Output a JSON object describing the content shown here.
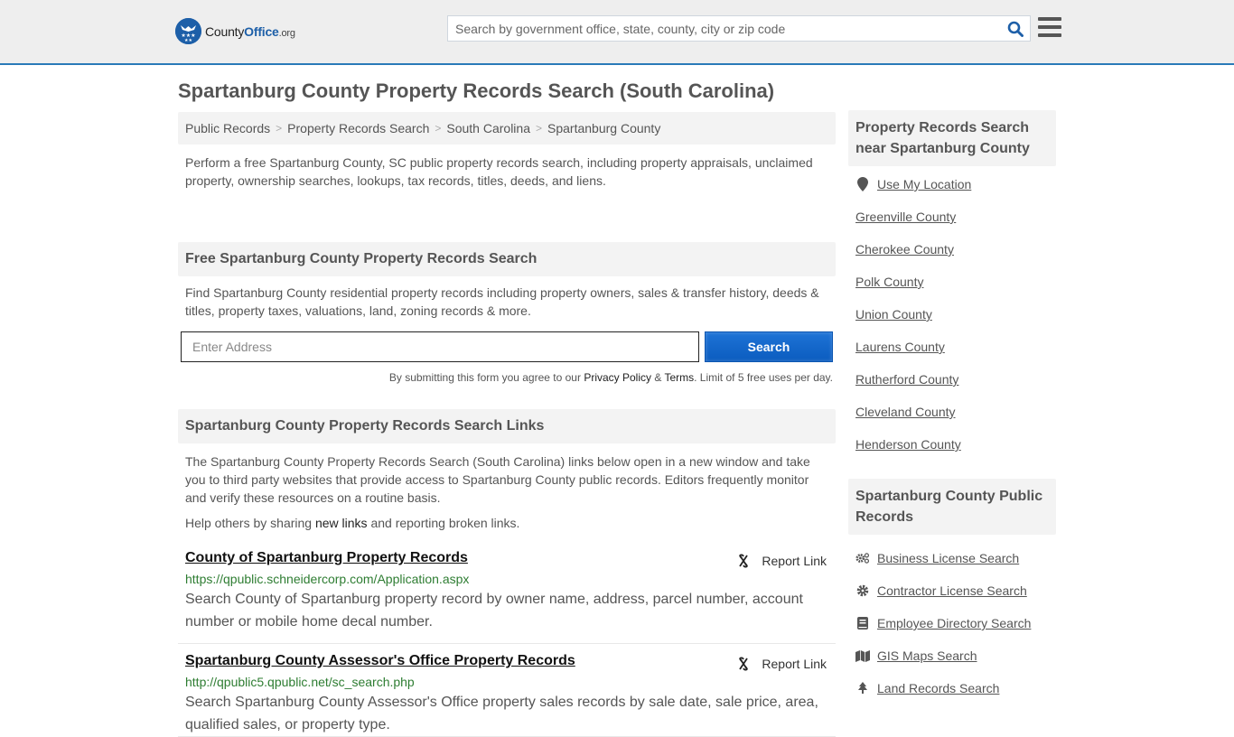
{
  "header": {
    "logo": {
      "county": "County",
      "office": "Office",
      "org": ".org"
    },
    "search_placeholder": "Search by government office, state, county, city or zip code"
  },
  "page_title": "Spartanburg County Property Records Search (South Carolina)",
  "breadcrumb": [
    {
      "label": "Public Records"
    },
    {
      "label": "Property Records Search"
    },
    {
      "label": "South Carolina"
    },
    {
      "label": "Spartanburg County"
    }
  ],
  "breadcrumb_separator": ">",
  "intro": "Perform a free Spartanburg County, SC public property records search, including property appraisals, unclaimed property, ownership searches, lookups, tax records, titles, deeds, and liens.",
  "free_search": {
    "heading": "Free Spartanburg County Property Records Search",
    "description": "Find Spartanburg County residential property records including property owners, sales & transfer history, deeds & titles, property taxes, valuations, land, zoning records & more.",
    "address_placeholder": "Enter Address",
    "address_value": "",
    "button_label": "Search",
    "disclaimer_prefix": "By submitting this form you agree to our ",
    "privacy_label": "Privacy Policy",
    "amp": " & ",
    "terms_label": "Terms",
    "disclaimer_suffix": ". Limit of 5 free uses per day."
  },
  "links_section": {
    "heading": "Spartanburg County Property Records Search Links",
    "description": "The Spartanburg County Property Records Search (South Carolina) links below open in a new window and take you to third party websites that provide access to Spartanburg County public records. Editors frequently monitor and verify these resources on a routine basis.",
    "help_prefix": "Help others by sharing ",
    "help_link": "new links",
    "help_suffix": " and reporting broken links.",
    "report_label": "Report Link",
    "records": [
      {
        "title": "County of Spartanburg Property Records",
        "url": "https://qpublic.schneidercorp.com/Application.aspx",
        "description": "Search County of Spartanburg property record by owner name, address, parcel number, account number or mobile home decal number."
      },
      {
        "title": "Spartanburg County Assessor's Office Property Records",
        "url": "http://qpublic5.qpublic.net/sc_search.php",
        "description": "Search Spartanburg County Assessor's Office property sales records by sale date, sale price, area, qualified sales, or property type."
      }
    ]
  },
  "sidebar": {
    "nearby": {
      "heading": "Property Records Search near Spartanburg County",
      "use_location": "Use My Location",
      "items": [
        "Greenville County",
        "Cherokee County",
        "Polk County",
        "Union County",
        "Laurens County",
        "Rutherford County",
        "Cleveland County",
        "Henderson County"
      ]
    },
    "public_records": {
      "heading": "Spartanburg County Public Records",
      "items": [
        {
          "label": "Business License Search",
          "icon": "cogs-icon"
        },
        {
          "label": "Contractor License Search",
          "icon": "gear-icon"
        },
        {
          "label": "Employee Directory Search",
          "icon": "book-icon"
        },
        {
          "label": "GIS Maps Search",
          "icon": "map-icon"
        },
        {
          "label": "Land Records Search",
          "icon": "tree-icon"
        }
      ]
    }
  },
  "colors": {
    "brand_blue": "#1d5fa8",
    "header_border": "#2a7ab8",
    "button_blue": "#0b5cbf",
    "url_green": "#2e7d32"
  }
}
